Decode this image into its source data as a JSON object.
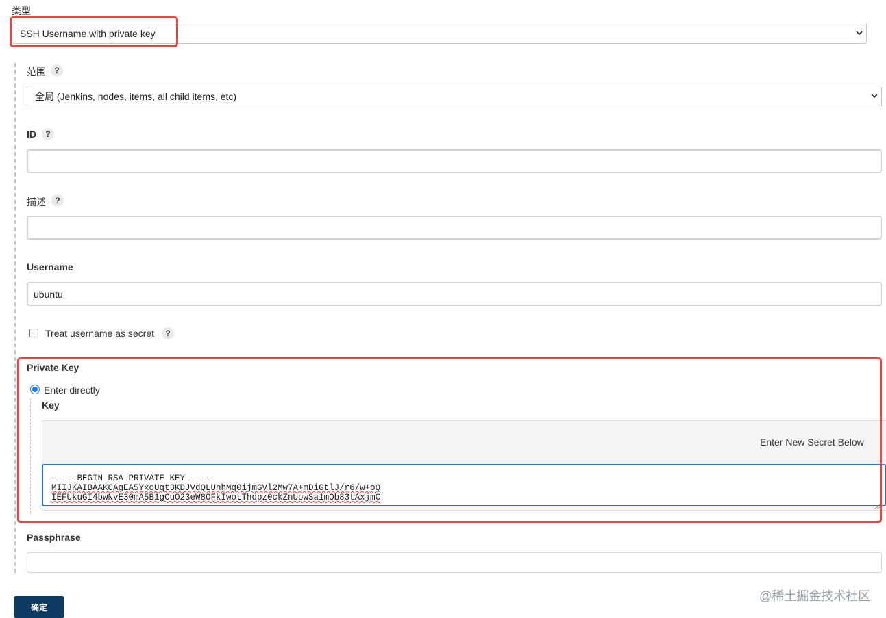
{
  "type_field": {
    "label": "类型",
    "value": "SSH Username with private key"
  },
  "scope_field": {
    "label": "范围",
    "help": "?",
    "value": "全局 (Jenkins, nodes, items, all child items, etc)"
  },
  "id_field": {
    "label": "ID",
    "help": "?",
    "value": ""
  },
  "description_field": {
    "label": "描述",
    "help": "?",
    "value": ""
  },
  "username_field": {
    "label": "Username",
    "value": "ubuntu"
  },
  "treat_secret": {
    "label": "Treat username as secret",
    "help": "?",
    "checked": false
  },
  "private_key": {
    "label": "Private Key",
    "option_label": "Enter directly",
    "selected": true,
    "key_label": "Key",
    "secret_hint": "Enter New Secret Below",
    "key_lines": [
      "-----BEGIN RSA PRIVATE KEY-----",
      "MIIJKAIBAAKCAgEA5YxoUqt3KDJVdQLUnhMq0ijmGVl2Mw7A+mDiGtlJ/r6/w+oQ",
      "IEFUkuGI4bwNvE30mA5B1gCuO23eW8OFkIwotThdpz0ckZnUowSa1mOb83tAxjmC"
    ]
  },
  "passphrase_field": {
    "label": "Passphrase",
    "value": ""
  },
  "actions": {
    "ok_label": "确定"
  },
  "watermark": "@稀土掘金技术社区",
  "colors": {
    "highlight_red": "#e04949",
    "button_blue": "#0d3a63",
    "radio_blue": "#1a73e8",
    "textarea_focus": "#2a6fd6"
  }
}
